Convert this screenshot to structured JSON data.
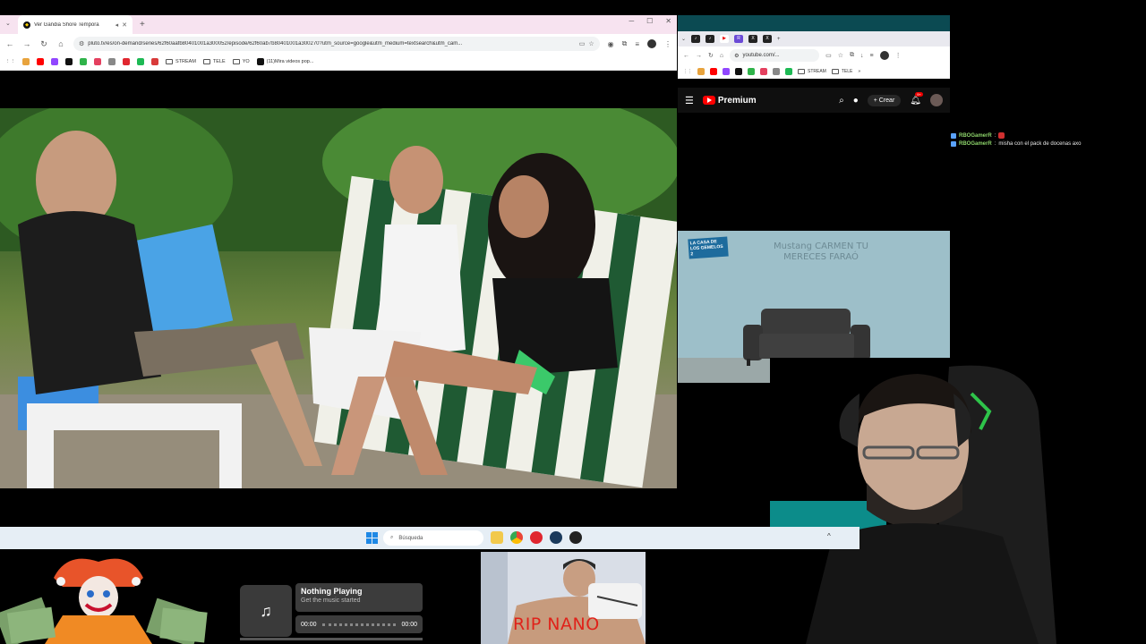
{
  "left_browser": {
    "tab_title": "Ver Gandia Shore Tempora",
    "url": "pluto.tv/es/on-demand/series/62f60aafb80401001a300052/episode/62f60ab7b80401001a300270?utm_source=google&utm_medium=textsearch&utm_cam...",
    "bookmarks": {
      "stream": "STREAM",
      "tele": "TELE",
      "yo": "YO",
      "mira": "(11)Mira videos pop..."
    }
  },
  "right_browser": {
    "url": "youtube.com/...",
    "bookmarks": {
      "stream": "STREAM",
      "tele": "TELE"
    },
    "yt_brand": "Premium",
    "yt_create": "Crear",
    "yt_badge": "9+",
    "show_logo": "LA CASA DE LOS GEMELOS 2",
    "wall_text": "Mustang CARMEN TU MERECES FARAÓ"
  },
  "chat": {
    "messages": [
      {
        "user": "RBOGamerR",
        "text": "",
        "emote": true
      },
      {
        "user": "RBOGamerR",
        "text": "misha con el pack de docenas axo",
        "emote": false
      }
    ]
  },
  "taskbar": {
    "search_placeholder": "Búsqueda"
  },
  "music": {
    "title": "Nothing Playing",
    "subtitle": "Get the music started",
    "time_start": "00:00",
    "time_end": "00:00",
    "progress": 0
  },
  "overlay": {
    "rip_text": "RIP NANO"
  },
  "colors": {
    "youtube_red": "#ff0000",
    "chat_user": "#8cd36a",
    "rip_red": "#e0221a",
    "taskbar": "#e6eef5"
  }
}
